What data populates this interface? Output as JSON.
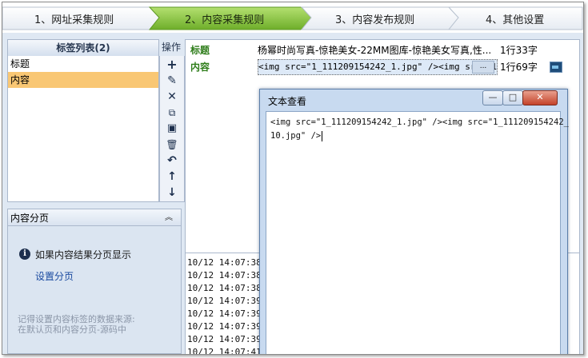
{
  "wizard": {
    "steps": [
      {
        "label": "1、网址采集规则",
        "active": false
      },
      {
        "label": "2、内容采集规则",
        "active": true
      },
      {
        "label": "3、内容发布规则",
        "active": false
      },
      {
        "label": "4、其他设置",
        "active": false
      }
    ],
    "active_color": "#8cc63e"
  },
  "tags": {
    "header": "标签列表(2)",
    "items": [
      {
        "label": "标题",
        "selected": false
      },
      {
        "label": "内容",
        "selected": true
      }
    ],
    "ops_header": "操作",
    "ops_icons": [
      "add-icon",
      "edit-icon",
      "delete-icon",
      "copy-icon",
      "paste-icon",
      "trash-icon",
      "undo-icon",
      "move-up-icon",
      "move-down-icon"
    ]
  },
  "pagination": {
    "header": "内容分页",
    "info": "如果内容结果分页显示",
    "link": "设置分页",
    "note": "记得设置内容标签的数据来源:\n在默认页和内容分页-源码中"
  },
  "results": {
    "rows": [
      {
        "label": "标题",
        "value": "杨幂时尚写真-惊艳美女-22MM图库-惊艳美女写真,性...",
        "count": "1行33字"
      },
      {
        "label": "内容",
        "value": "<img src=\"1_111209154242_1.jpg\" /><img src=\"1",
        "ellipsis": "...",
        "count": "1行69字"
      }
    ],
    "log_lines": [
      "10/12 14:07:38",
      "10/12 14:07:38",
      "10/12 14:07:38",
      "10/12 14:07:39",
      "10/12 14:07:39",
      "10/12 14:07:39",
      "10/12 14:07:39",
      "10/12 14:07:41"
    ]
  },
  "popup": {
    "title": "文本查看",
    "text": "<img src=\"1_111209154242_1.jpg\" /><img src=\"1_111209154242_\n10.jpg\" />"
  },
  "colors": {
    "selected_row": "#f9c774",
    "label_green": "#2e7d1a",
    "panel_bg": "#dbe5f1"
  }
}
